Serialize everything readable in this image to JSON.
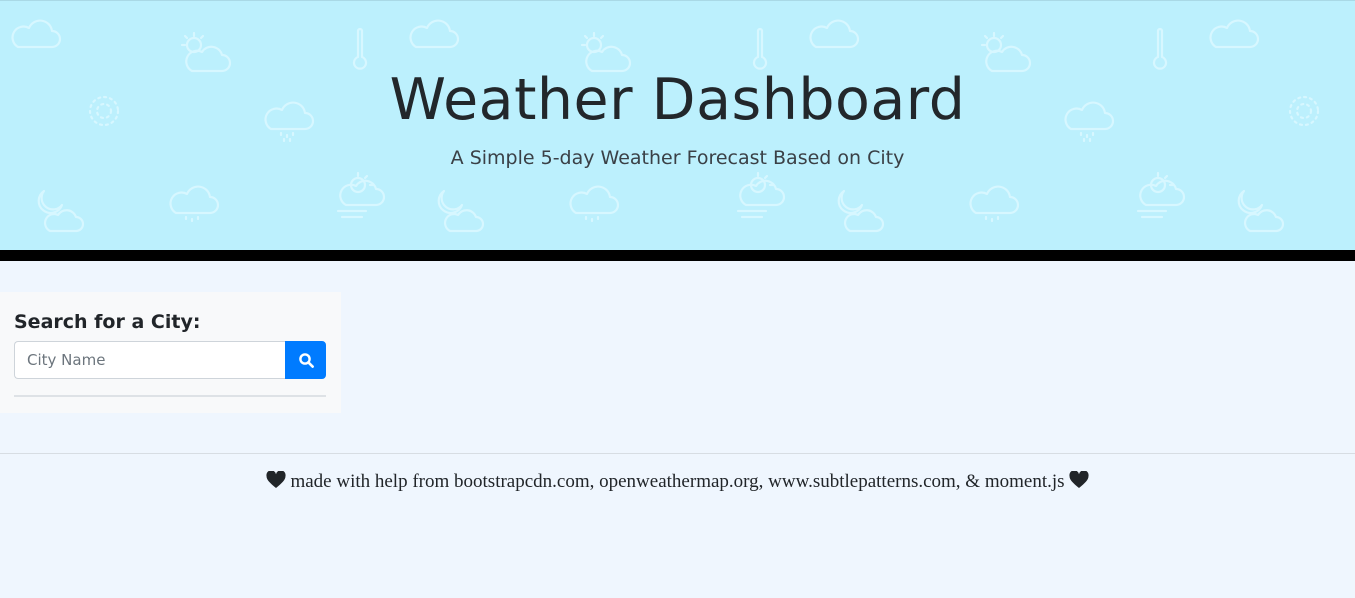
{
  "header": {
    "title": "Weather Dashboard",
    "subtitle": "A Simple 5-day Weather Forecast Based on City",
    "background_color": "#bcf0fd",
    "pattern_icons": [
      "cloud-icon",
      "sun-cloud-icon",
      "thermometer-icon",
      "snowflake-icon",
      "rain-cloud-icon",
      "wind-cloud-icon",
      "moon-cloud-icon"
    ]
  },
  "search": {
    "label": "Search for a City:",
    "input_value": "",
    "placeholder": "City Name",
    "button_icon": "search-icon",
    "button_color": "#007bff"
  },
  "footer": {
    "text": "made with help from bootstrapcdn.com, openweathermap.org, www.subtlepatterns.com, & moment.js",
    "icon": "heart-icon"
  }
}
